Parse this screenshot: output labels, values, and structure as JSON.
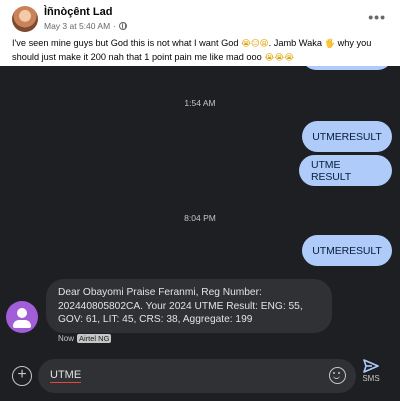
{
  "post": {
    "author": "Ìñnòçênt Lad",
    "time": "May 3 at 5:40 AM",
    "more": "•••",
    "text_start": "I've seen mine guys but God this is not what I want God ",
    "emojis_1": "😭😑😫",
    "text_mid": ". Jamb Waka ",
    "emoji_2": "🖐",
    "text_end": " why you should just make it 200 nah that 1 point pain me like mad ooo ",
    "emojis_3": "😭😭😭"
  },
  "chat": {
    "timestamps": [
      "1:54 AM",
      "8:04 PM"
    ],
    "sent": [
      "UTMERESULT",
      "UTME RESULT",
      "UTMERESULT"
    ],
    "received": {
      "text": "Dear Obayomi Praise Feranmi, Reg Number: 202440805802CA. Your 2024 UTME Result: ENG: 55, GOV: 61, LIT: 45, CRS: 38, Aggregate: 199",
      "status": "Now",
      "sim": "Airtel NG"
    }
  },
  "compose": {
    "value": "UTME",
    "send_label": "SMS"
  },
  "colors": {
    "sent_bubble": "#aecbfa",
    "received_bubble": "#303134",
    "background": "#1e1f22",
    "contact_avatar": "#a25ed8"
  },
  "icons": [
    "globe-icon",
    "more-icon",
    "contact-avatar-icon",
    "add-icon",
    "emoji-icon",
    "send-icon"
  ]
}
